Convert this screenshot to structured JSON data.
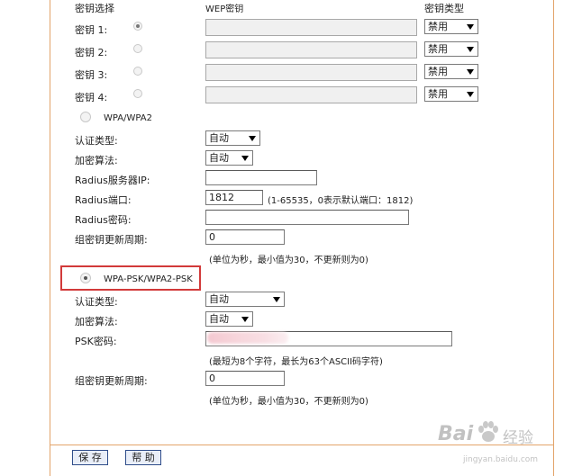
{
  "wep": {
    "col_key_select": "密钥选择",
    "col_wep_key": "WEP密钥",
    "col_key_type": "密钥类型",
    "keys": [
      {
        "label": "密钥 1:",
        "type": "禁用"
      },
      {
        "label": "密钥 2:",
        "type": "禁用"
      },
      {
        "label": "密钥 3:",
        "type": "禁用"
      },
      {
        "label": "密钥 4:",
        "type": "禁用"
      }
    ]
  },
  "wpa": {
    "mode_label": "WPA/WPA2",
    "auth_type_label": "认证类型:",
    "auth_type_value": "自动",
    "encryption_label": "加密算法:",
    "encryption_value": "自动",
    "radius_ip_label": "Radius服务器IP:",
    "radius_ip_value": "",
    "radius_port_label": "Radius端口:",
    "radius_port_value": "1812",
    "radius_port_hint": "(1-65535，0表示默认端口：1812)",
    "radius_password_label": "Radius密码:",
    "radius_password_value": "",
    "group_key_period_label": "组密钥更新周期:",
    "group_key_period_value": "0",
    "group_key_period_hint": "(单位为秒，最小值为30，不更新则为0)"
  },
  "wpa_psk": {
    "mode_label": "WPA-PSK/WPA2-PSK",
    "auth_type_label": "认证类型:",
    "auth_type_value": "自动",
    "encryption_label": "加密算法:",
    "encryption_value": "自动",
    "psk_password_label": "PSK密码:",
    "psk_password_value": "",
    "psk_password_hint": "(最短为8个字符，最长为63个ASCII码字符)",
    "group_key_period_label": "组密钥更新周期:",
    "group_key_period_value": "0",
    "group_key_period_hint": "(单位为秒，最小值为30，不更新则为0)"
  },
  "buttons": {
    "save": "保 存",
    "help": "帮 助"
  },
  "watermark": {
    "brand": "Bai",
    "brand_suffix": "经验",
    "url": "jingyan.baidu.com"
  },
  "colors": {
    "panel_border": "#e3a46a",
    "highlight": "#d23a3a",
    "button_border": "#2f4d8a"
  }
}
